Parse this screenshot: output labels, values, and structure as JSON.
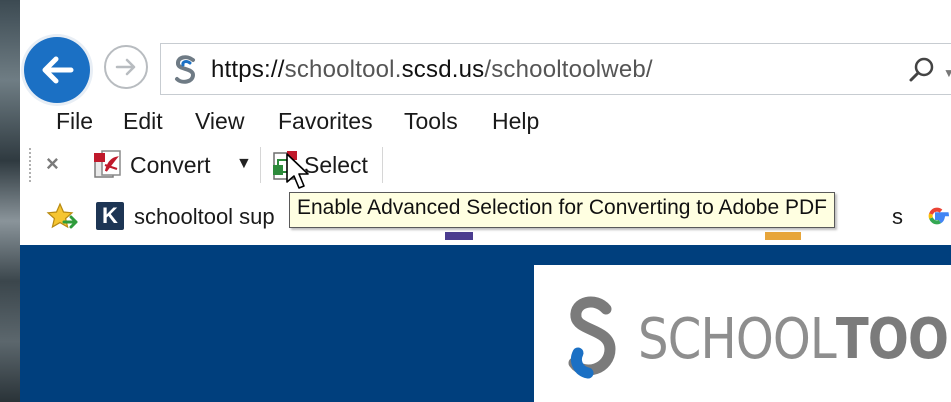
{
  "browser": {
    "address_bar": {
      "url_scheme": "https://",
      "url_host_sub": "schooltool.",
      "url_host_main": "scsd.us",
      "url_path": "/schooltoolweb/"
    },
    "menu": [
      "File",
      "Edit",
      "View",
      "Favorites",
      "Tools",
      "Help"
    ],
    "toolbar": {
      "close_glyph": "×",
      "convert_label": "Convert",
      "select_label": "Select"
    },
    "favorites": {
      "item_1_badge": "K",
      "item_1_label": "schooltool sup",
      "item_tail_text": "s"
    },
    "tooltip": "Enable Advanced Selection for Converting to Adobe PDF"
  },
  "page": {
    "logo_light": "SCHOOL",
    "logo_bold": "TOOL"
  },
  "colors": {
    "accent_blue": "#1b70c4",
    "page_bg": "#003f7d",
    "tooltip_bg": "#ffffe1"
  },
  "icons": {
    "back": "arrow-left-icon",
    "forward": "arrow-right-icon",
    "site": "schooltool-s-icon",
    "search": "search-icon",
    "convert": "pdf-convert-icon",
    "select": "pdf-select-icon",
    "favorites": "add-favorite-star-icon",
    "google": "google-g-icon"
  }
}
